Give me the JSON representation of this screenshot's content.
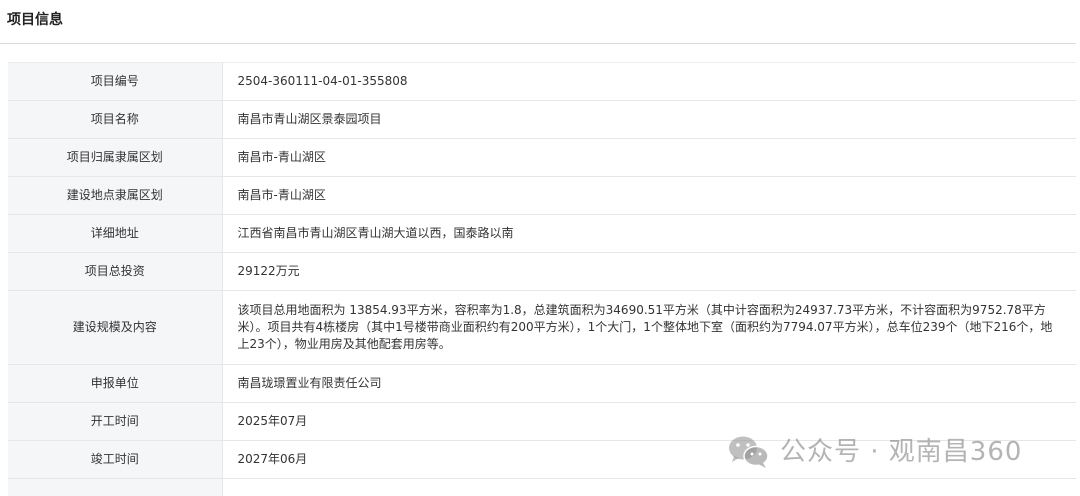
{
  "section": {
    "title": "项目信息"
  },
  "rows": [
    {
      "label": "项目编号",
      "value": "2504-360111-04-01-355808"
    },
    {
      "label": "项目名称",
      "value": "南昌市青山湖区景泰园项目"
    },
    {
      "label": "项目归属隶属区划",
      "value": "南昌市-青山湖区"
    },
    {
      "label": "建设地点隶属区划",
      "value": "南昌市-青山湖区"
    },
    {
      "label": "详细地址",
      "value": "江西省南昌市青山湖区青山湖大道以西，国泰路以南"
    },
    {
      "label": "项目总投资",
      "value": "29122万元"
    },
    {
      "label": "建设规模及内容",
      "value": "该项目总用地面积为 13854.93平方米，容积率为1.8，总建筑面积为34690.51平方米（其中计容面积为24937.73平方米，不计容面积为9752.78平方米）。项目共有4栋楼房（其中1号楼带商业面积约有200平方米），1个大门，1个整体地下室（面积约为7794.07平方米），总车位239个（地下216个，地上23个），物业用房及其他配套用房等。"
    },
    {
      "label": "申报单位",
      "value": "南昌珑璟置业有限责任公司"
    },
    {
      "label": "开工时间",
      "value": "2025年07月"
    },
    {
      "label": "竣工时间",
      "value": "2027年06月"
    }
  ],
  "watermark": {
    "icon": "wechat-icon",
    "text": "公众号 · 观南昌360"
  }
}
